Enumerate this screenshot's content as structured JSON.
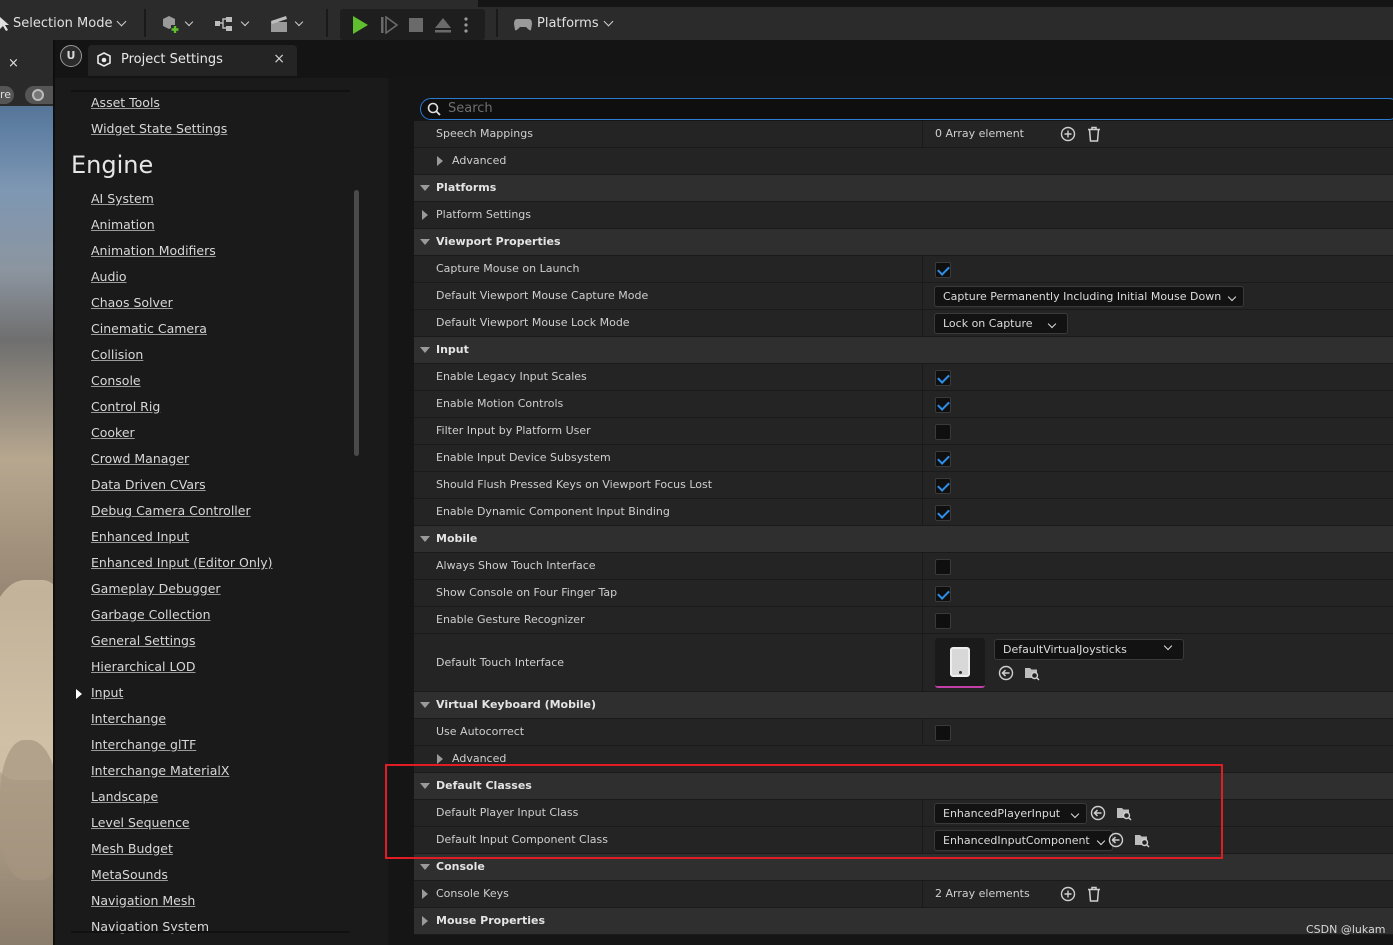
{
  "toolbar": {
    "selection_mode": "Selection Mode",
    "platforms": "Platforms"
  },
  "tab": {
    "title": "Project Settings",
    "close": "×"
  },
  "viewport": {
    "close": "×",
    "pill_text": "re"
  },
  "nav": {
    "top_items": [
      "Asset Tools",
      "Widget State Settings"
    ],
    "heading": "Engine",
    "items": [
      "AI System",
      "Animation",
      "Animation Modifiers",
      "Audio",
      "Chaos Solver",
      "Cinematic Camera",
      "Collision",
      "Console",
      "Control Rig",
      "Cooker",
      "Crowd Manager",
      "Data Driven CVars",
      "Debug Camera Controller",
      "Enhanced Input",
      "Enhanced Input (Editor Only)",
      "Gameplay Debugger",
      "Garbage Collection",
      "General Settings",
      "Hierarchical LOD",
      "Input",
      "Interchange",
      "Interchange glTF",
      "Interchange MaterialX",
      "Landscape",
      "Level Sequence",
      "Mesh Budget",
      "MetaSounds",
      "Navigation Mesh",
      "Navigation System"
    ],
    "selected": "Input"
  },
  "search": {
    "placeholder": "Search"
  },
  "details": {
    "speech_mappings": {
      "label": "Speech Mappings",
      "value": "0 Array element"
    },
    "advanced_1": "Advanced",
    "platforms": {
      "header": "Platforms",
      "platform_settings": "Platform Settings"
    },
    "viewport_properties": {
      "header": "Viewport Properties",
      "capture_mouse": {
        "label": "Capture Mouse on Launch",
        "checked": true
      },
      "capture_mode": {
        "label": "Default Viewport Mouse Capture Mode",
        "value": "Capture Permanently Including Initial Mouse Down"
      },
      "lock_mode": {
        "label": "Default Viewport Mouse Lock Mode",
        "value": "Lock on Capture"
      }
    },
    "input": {
      "header": "Input",
      "rows": [
        {
          "label": "Enable Legacy Input Scales",
          "checked": true
        },
        {
          "label": "Enable Motion Controls",
          "checked": true
        },
        {
          "label": "Filter Input by Platform User",
          "checked": false
        },
        {
          "label": "Enable Input Device Subsystem",
          "checked": true
        },
        {
          "label": "Should Flush Pressed Keys on Viewport Focus Lost",
          "checked": true
        },
        {
          "label": "Enable Dynamic Component Input Binding",
          "checked": true
        }
      ]
    },
    "mobile": {
      "header": "Mobile",
      "rows": [
        {
          "label": "Always Show Touch Interface",
          "checked": false
        },
        {
          "label": "Show Console on Four Finger Tap",
          "checked": true
        },
        {
          "label": "Enable Gesture Recognizer",
          "checked": false
        }
      ],
      "touch_interface": {
        "label": "Default Touch Interface",
        "value": "DefaultVirtualJoysticks"
      }
    },
    "virtual_keyboard": {
      "header": "Virtual Keyboard (Mobile)",
      "use_autocorrect": {
        "label": "Use Autocorrect",
        "checked": false
      },
      "advanced": "Advanced"
    },
    "default_classes": {
      "header": "Default Classes",
      "player_input": {
        "label": "Default Player Input Class",
        "value": "EnhancedPlayerInput"
      },
      "input_component": {
        "label": "Default Input Component Class",
        "value": "EnhancedInputComponent"
      }
    },
    "console": {
      "header": "Console",
      "console_keys": {
        "label": "Console Keys",
        "value": "2 Array elements"
      }
    },
    "mouse_properties": {
      "header": "Mouse Properties"
    }
  },
  "watermark": "CSDN @lukam",
  "colors": {
    "accent": "#2f8fe8",
    "highlight": "#e01c24",
    "play": "#5fbf2f"
  }
}
